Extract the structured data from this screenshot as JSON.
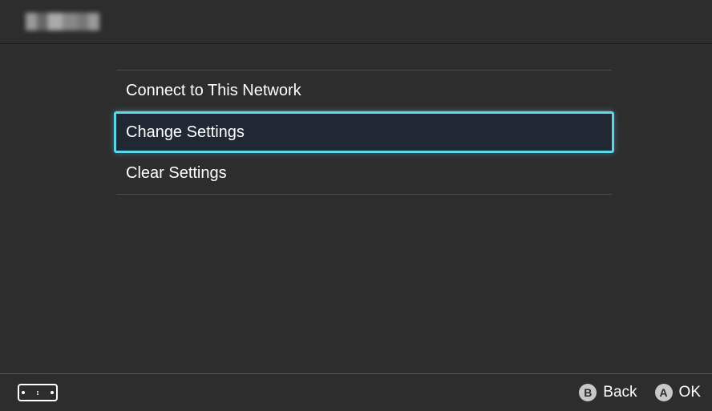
{
  "header": {
    "title_obscured": true
  },
  "menu": {
    "items": [
      {
        "label": "Connect to This Network",
        "selected": false
      },
      {
        "label": "Change Settings",
        "selected": true
      },
      {
        "label": "Clear Settings",
        "selected": false
      }
    ]
  },
  "footer": {
    "actions": [
      {
        "button": "B",
        "label": "Back"
      },
      {
        "button": "A",
        "label": "OK"
      }
    ]
  }
}
